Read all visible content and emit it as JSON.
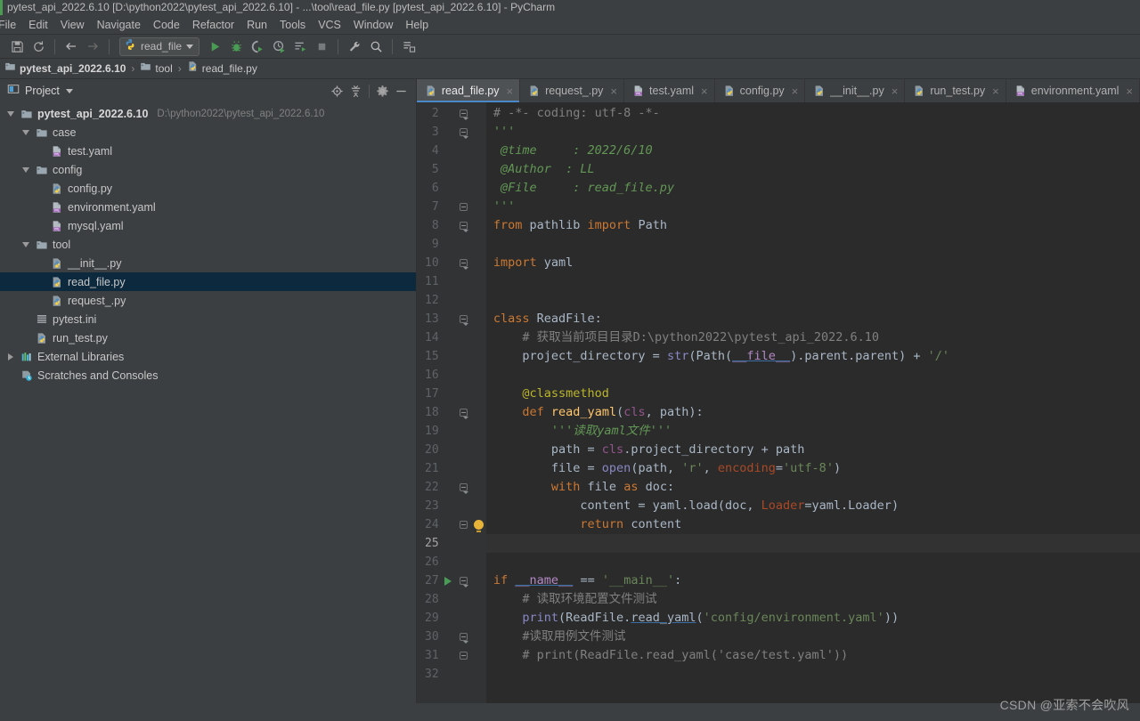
{
  "window": {
    "title": "pytest_api_2022.6.10 [D:\\python2022\\pytest_api_2022.6.10] - ...\\tool\\read_file.py [pytest_api_2022.6.10] - PyCharm"
  },
  "menubar": {
    "items": [
      "File",
      "Edit",
      "View",
      "Navigate",
      "Code",
      "Refactor",
      "Run",
      "Tools",
      "VCS",
      "Window",
      "Help"
    ]
  },
  "toolbar": {
    "icons": [
      "save-icon",
      "sync-icon",
      "back-arrow-icon",
      "forward-arrow-icon"
    ],
    "run_config": {
      "label": "read_file",
      "icon": "python-file-icon"
    },
    "actions": [
      "run-icon",
      "debug-icon",
      "run-coverage-icon",
      "profile-icon",
      "run-with-console-icon",
      "stop-icon",
      "settings-wrench-icon",
      "search-icon",
      "layout-icon"
    ]
  },
  "breadcrumb": {
    "items": [
      {
        "label": "pytest_api_2022.6.10",
        "icon": "project-folder-icon"
      },
      {
        "label": "tool",
        "icon": "folder-icon"
      },
      {
        "label": "read_file.py",
        "icon": "python-file-icon"
      }
    ],
    "separator": "›"
  },
  "project_panel": {
    "title": "Project",
    "header_icons": [
      "locate-target-icon",
      "collapse-all-icon",
      "gear-icon",
      "minimize-icon"
    ],
    "tree": [
      {
        "label": "pytest_api_2022.6.10",
        "path": "D:\\python2022\\pytest_api_2022.6.10",
        "icon": "project-folder-icon",
        "indent": 0,
        "twisty": "down",
        "root": true,
        "selected": false
      },
      {
        "label": "case",
        "path": "",
        "icon": "folder-icon",
        "indent": 1,
        "twisty": "down",
        "root": false,
        "selected": false
      },
      {
        "label": "test.yaml",
        "path": "",
        "icon": "yaml-file-icon",
        "indent": 2,
        "twisty": "none",
        "root": false,
        "selected": false
      },
      {
        "label": "config",
        "path": "",
        "icon": "folder-icon",
        "indent": 1,
        "twisty": "down",
        "root": false,
        "selected": false
      },
      {
        "label": "config.py",
        "path": "",
        "icon": "python-file-icon",
        "indent": 2,
        "twisty": "none",
        "root": false,
        "selected": false
      },
      {
        "label": "environment.yaml",
        "path": "",
        "icon": "yaml-file-icon",
        "indent": 2,
        "twisty": "none",
        "root": false,
        "selected": false
      },
      {
        "label": "mysql.yaml",
        "path": "",
        "icon": "yaml-file-icon",
        "indent": 2,
        "twisty": "none",
        "root": false,
        "selected": false
      },
      {
        "label": "tool",
        "path": "",
        "icon": "folder-icon",
        "indent": 1,
        "twisty": "down",
        "root": false,
        "selected": false
      },
      {
        "label": "__init__.py",
        "path": "",
        "icon": "python-file-icon",
        "indent": 2,
        "twisty": "none",
        "root": false,
        "selected": false
      },
      {
        "label": "read_file.py",
        "path": "",
        "icon": "python-file-icon",
        "indent": 2,
        "twisty": "none",
        "root": false,
        "selected": true
      },
      {
        "label": "request_.py",
        "path": "",
        "icon": "python-file-icon",
        "indent": 2,
        "twisty": "none",
        "root": false,
        "selected": false
      },
      {
        "label": "pytest.ini",
        "path": "",
        "icon": "ini-file-icon",
        "indent": 1,
        "twisty": "none",
        "root": false,
        "selected": false
      },
      {
        "label": "run_test.py",
        "path": "",
        "icon": "python-file-icon",
        "indent": 1,
        "twisty": "none",
        "root": false,
        "selected": false
      },
      {
        "label": "External Libraries",
        "path": "",
        "icon": "libraries-icon",
        "indent": 0,
        "twisty": "right",
        "root": false,
        "selected": false
      },
      {
        "label": "Scratches and Consoles",
        "path": "",
        "icon": "scratches-icon",
        "indent": 0,
        "twisty": "none",
        "root": false,
        "selected": false
      }
    ]
  },
  "editor_tabs": [
    {
      "label": "read_file.py",
      "icon": "python-file-icon",
      "active": true
    },
    {
      "label": "request_.py",
      "icon": "python-file-icon",
      "active": false
    },
    {
      "label": "test.yaml",
      "icon": "yaml-file-icon",
      "active": false
    },
    {
      "label": "config.py",
      "icon": "python-file-icon",
      "active": false
    },
    {
      "label": "__init__.py",
      "icon": "python-file-icon",
      "active": false
    },
    {
      "label": "run_test.py",
      "icon": "python-file-icon",
      "active": false
    },
    {
      "label": "environment.yaml",
      "icon": "yaml-file-icon",
      "active": false
    }
  ],
  "editor": {
    "first_visible_line": 2,
    "current_line": 25,
    "lines": [
      {
        "n": 2,
        "text": "# -*- coding: utf-8 -*-",
        "gutter": "fold-open"
      },
      {
        "n": 3,
        "text": "'''",
        "gutter": "fold-open"
      },
      {
        "n": 4,
        "text": " @time     : 2022/6/10",
        "gutter": ""
      },
      {
        "n": 5,
        "text": " @Author  : LL",
        "gutter": ""
      },
      {
        "n": 6,
        "text": " @File     : read_file.py",
        "gutter": ""
      },
      {
        "n": 7,
        "text": "'''",
        "gutter": "fold-end"
      },
      {
        "n": 8,
        "text": "from pathlib import Path",
        "gutter": "fold-open"
      },
      {
        "n": 9,
        "text": "",
        "gutter": ""
      },
      {
        "n": 10,
        "text": "import yaml",
        "gutter": "fold-open"
      },
      {
        "n": 11,
        "text": "",
        "gutter": ""
      },
      {
        "n": 12,
        "text": "",
        "gutter": ""
      },
      {
        "n": 13,
        "text": "class ReadFile:",
        "gutter": "fold-open"
      },
      {
        "n": 14,
        "text": "    # 获取当前项目目录D:\\python2022\\pytest_api_2022.6.10",
        "gutter": ""
      },
      {
        "n": 15,
        "text": "    project_directory = str(Path(__file__).parent.parent) + '/'",
        "gutter": ""
      },
      {
        "n": 16,
        "text": "",
        "gutter": ""
      },
      {
        "n": 17,
        "text": "    @classmethod",
        "gutter": ""
      },
      {
        "n": 18,
        "text": "    def read_yaml(cls, path):",
        "gutter": "fold-open"
      },
      {
        "n": 19,
        "text": "        '''读取yaml文件'''",
        "gutter": ""
      },
      {
        "n": 20,
        "text": "        path = cls.project_directory + path",
        "gutter": ""
      },
      {
        "n": 21,
        "text": "        file = open(path, 'r', encoding='utf-8')",
        "gutter": ""
      },
      {
        "n": 22,
        "text": "        with file as doc:",
        "gutter": "fold-open"
      },
      {
        "n": 23,
        "text": "            content = yaml.load(doc, Loader=yaml.Loader)",
        "gutter": ""
      },
      {
        "n": 24,
        "text": "            return content",
        "gutter": "fold-end-bulb"
      },
      {
        "n": 25,
        "text": "",
        "gutter": ""
      },
      {
        "n": 26,
        "text": "",
        "gutter": ""
      },
      {
        "n": 27,
        "text": "if __name__ == '__main__':",
        "gutter": "run-fold-open"
      },
      {
        "n": 28,
        "text": "    # 读取环境配置文件测试",
        "gutter": ""
      },
      {
        "n": 29,
        "text": "    print(ReadFile.read_yaml('config/environment.yaml'))",
        "gutter": ""
      },
      {
        "n": 30,
        "text": "    #读取用例文件测试",
        "gutter": "fold-open"
      },
      {
        "n": 31,
        "text": "    # print(ReadFile.read_yaml('case/test.yaml'))",
        "gutter": "fold-end"
      },
      {
        "n": 32,
        "text": "",
        "gutter": ""
      }
    ]
  },
  "watermark": {
    "text": "CSDN @亚索不会吹风"
  },
  "colors": {
    "accent_blue": "#4a88c7",
    "selection_blue": "#0d293e",
    "editor_bg": "#2b2b2b",
    "gutter_bg": "#313335",
    "panel_bg": "#3c3f41",
    "keyword_orange": "#cc7832",
    "string_green": "#6a8759",
    "docstring_green": "#629755",
    "comment_gray": "#808080",
    "number_blue": "#6897bb",
    "function_yellow": "#ffc66d",
    "decorator_olive": "#bbb529",
    "text_default": "#a9b7c6",
    "run_green": "#499c54",
    "bulb_yellow": "#e8b339"
  }
}
